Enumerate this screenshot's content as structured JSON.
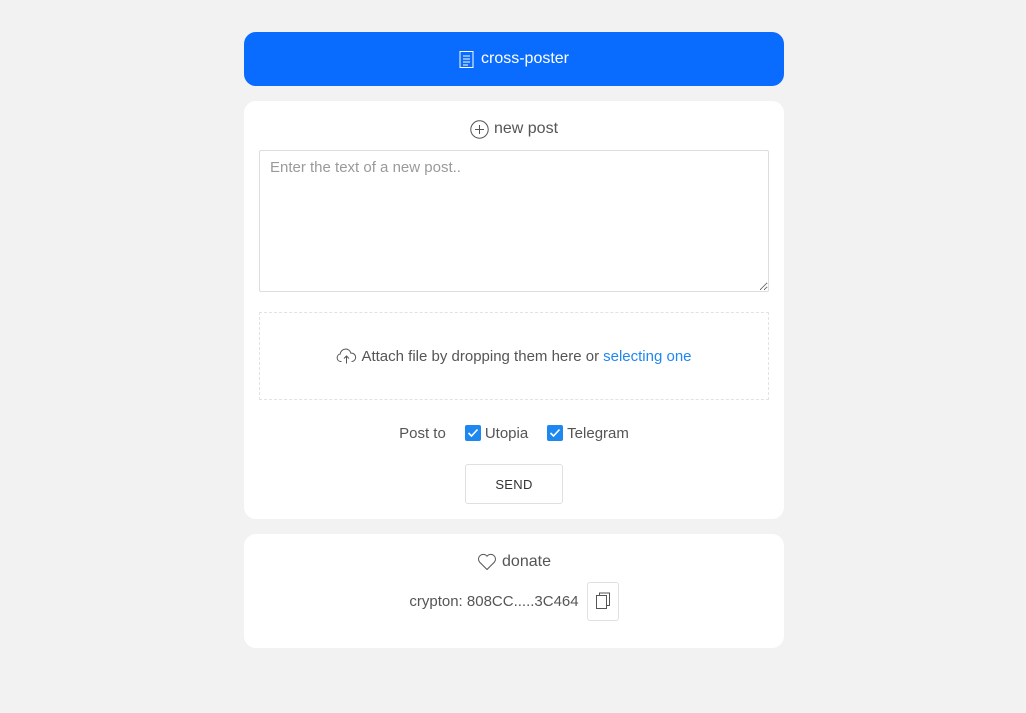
{
  "header": {
    "title": "cross-poster",
    "icon": "document-icon"
  },
  "new_post": {
    "title": "new post",
    "icon": "plus-circle-icon",
    "textarea_placeholder": "Enter the text of a new post..",
    "textarea_value": "",
    "attach_text": "Attach file by dropping them here or",
    "attach_link": "selecting one",
    "attach_icon": "cloud-upload-icon",
    "post_to_label": "Post to",
    "targets": [
      {
        "label": "Utopia",
        "checked": true
      },
      {
        "label": "Telegram",
        "checked": true
      }
    ],
    "send_label": "SEND"
  },
  "donate": {
    "title": "donate",
    "icon": "heart-icon",
    "wallet_text": "crypton: 808CC.....3C464",
    "copy_icon": "copy-icon"
  },
  "colors": {
    "accent": "#0a6cff",
    "link": "#1e87f0",
    "background": "#f2f2f2",
    "card": "#ffffff"
  }
}
